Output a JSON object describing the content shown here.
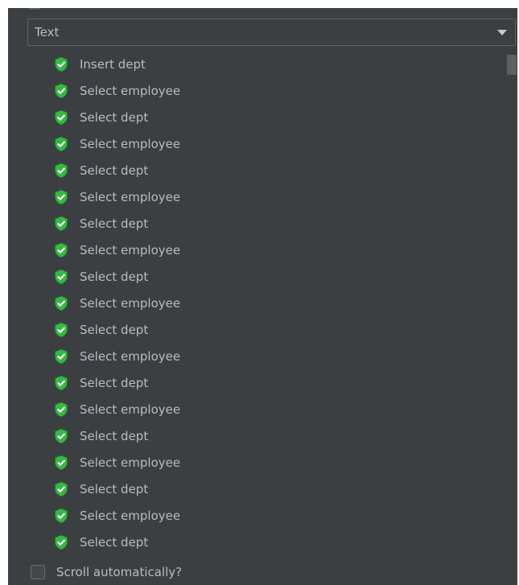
{
  "filter": {
    "selected": "Text"
  },
  "results": {
    "items": [
      {
        "label": "Insert dept",
        "status": "pass"
      },
      {
        "label": "Select employee",
        "status": "pass"
      },
      {
        "label": "Select dept",
        "status": "pass"
      },
      {
        "label": "Select employee",
        "status": "pass"
      },
      {
        "label": "Select dept",
        "status": "pass"
      },
      {
        "label": "Select employee",
        "status": "pass"
      },
      {
        "label": "Select dept",
        "status": "pass"
      },
      {
        "label": "Select employee",
        "status": "pass"
      },
      {
        "label": "Select dept",
        "status": "pass"
      },
      {
        "label": "Select employee",
        "status": "pass"
      },
      {
        "label": "Select dept",
        "status": "pass"
      },
      {
        "label": "Select employee",
        "status": "pass"
      },
      {
        "label": "Select dept",
        "status": "pass"
      },
      {
        "label": "Select employee",
        "status": "pass"
      },
      {
        "label": "Select dept",
        "status": "pass"
      },
      {
        "label": "Select employee",
        "status": "pass"
      },
      {
        "label": "Select dept",
        "status": "pass"
      },
      {
        "label": "Select employee",
        "status": "pass"
      },
      {
        "label": "Select dept",
        "status": "pass"
      }
    ]
  },
  "options": {
    "scroll_label": "Scroll automatically?",
    "scroll_checked": false
  },
  "icons": {
    "status": "shield-check-icon",
    "dropdown": "chevron-down-icon"
  },
  "colors": {
    "panel_bg": "#3c3f41",
    "text": "#bbbbbb",
    "success_green": "#36b845"
  }
}
